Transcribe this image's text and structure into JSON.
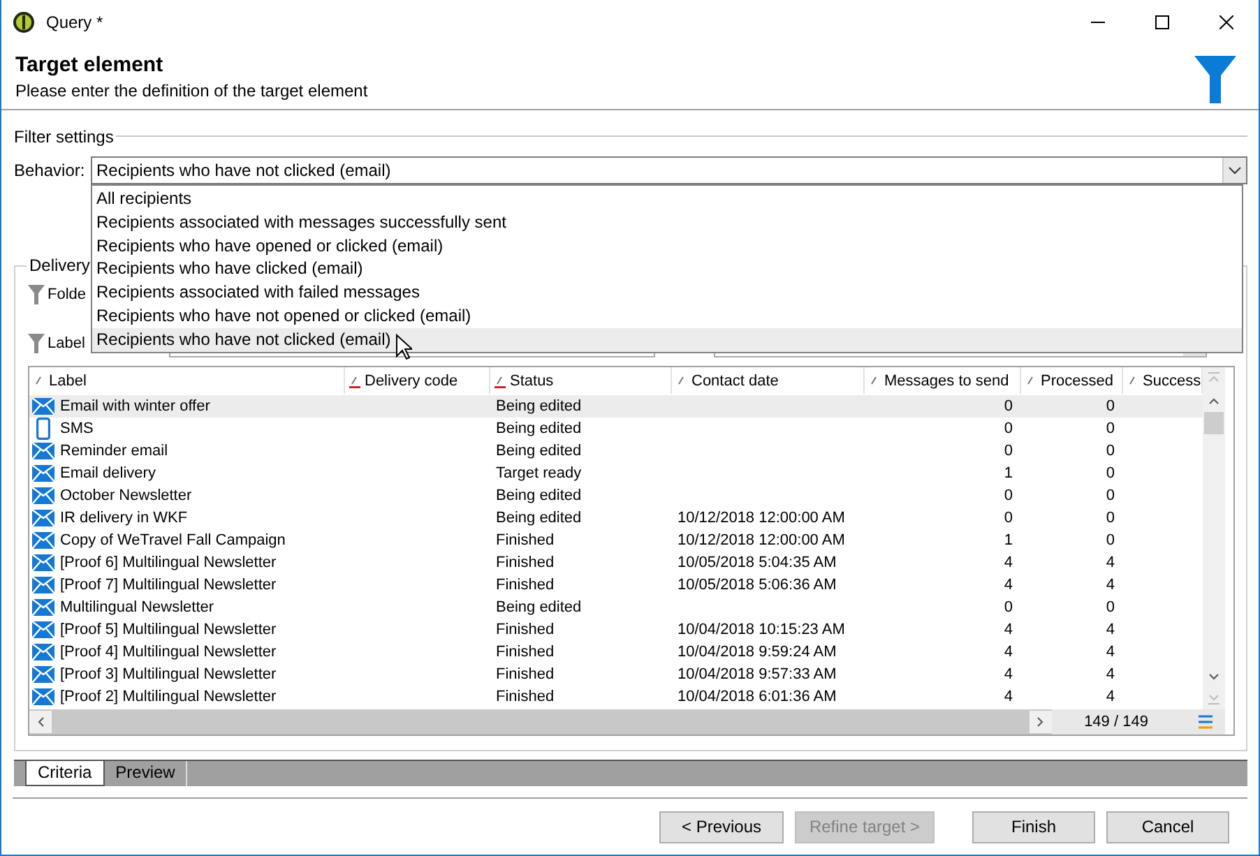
{
  "window": {
    "title": "Query *"
  },
  "header": {
    "title": "Target element",
    "subtitle": "Please enter the definition of the target element"
  },
  "filter_settings": {
    "legend": "Filter settings",
    "behavior_label": "Behavior:",
    "behavior_value": "Recipients who have not clicked (email)",
    "options": [
      {
        "label": "All recipients",
        "selected": false
      },
      {
        "label": "Recipients associated with messages successfully sent",
        "selected": false
      },
      {
        "label": "Recipients who have opened or clicked (email)",
        "selected": false
      },
      {
        "label": "Recipients who have clicked (email)",
        "selected": false
      },
      {
        "label": "Recipients associated with failed messages",
        "selected": false
      },
      {
        "label": "Recipients who have not opened or clicked (email)",
        "selected": false
      },
      {
        "label": "Recipients who have not clicked (email)",
        "selected": true
      }
    ]
  },
  "delivery": {
    "legend": "Delivery",
    "folder_label": "Folde",
    "label_label": "Label"
  },
  "table": {
    "columns": [
      {
        "label": "Label",
        "marked": false
      },
      {
        "label": "Delivery code",
        "marked": true
      },
      {
        "label": "Status",
        "marked": true
      },
      {
        "label": "Contact date",
        "marked": false
      },
      {
        "label": "Messages to send",
        "marked": false
      },
      {
        "label": "Processed",
        "marked": false
      },
      {
        "label": "Success",
        "marked": false
      }
    ],
    "rows": [
      {
        "kind": "email",
        "label": "Email with winter offer",
        "status": "Being edited",
        "to_send": "0",
        "processed": "0",
        "selected": true
      },
      {
        "kind": "sms",
        "label": "SMS",
        "status": "Being edited",
        "to_send": "0",
        "processed": "0",
        "selected": false
      },
      {
        "kind": "email",
        "label": "Reminder email",
        "status": "Being edited",
        "to_send": "0",
        "processed": "0",
        "selected": false
      },
      {
        "kind": "email",
        "label": "Email delivery",
        "status": "Target ready",
        "to_send": "1",
        "processed": "0",
        "selected": false
      },
      {
        "kind": "email",
        "label": "October Newsletter",
        "status": "Being edited",
        "to_send": "0",
        "processed": "0",
        "selected": false
      },
      {
        "kind": "email",
        "label": "IR delivery in WKF",
        "status": "Being edited",
        "contact_date": "10/12/2018 12:00:00 AM",
        "to_send": "0",
        "processed": "0",
        "selected": false
      },
      {
        "kind": "email",
        "label": "Copy of WeTravel Fall Campaign",
        "status": "Finished",
        "contact_date": "10/12/2018 12:00:00 AM",
        "to_send": "1",
        "processed": "0",
        "selected": false
      },
      {
        "kind": "email",
        "label": "[Proof 6] Multilingual Newsletter",
        "status": "Finished",
        "contact_date": "10/05/2018 5:04:35 AM",
        "to_send": "4",
        "processed": "4",
        "selected": false
      },
      {
        "kind": "email",
        "label": "[Proof 7] Multilingual Newsletter",
        "status": "Finished",
        "contact_date": "10/05/2018 5:06:36 AM",
        "to_send": "4",
        "processed": "4",
        "selected": false
      },
      {
        "kind": "email",
        "label": "Multilingual Newsletter",
        "status": "Being edited",
        "to_send": "0",
        "processed": "0",
        "selected": false
      },
      {
        "kind": "email",
        "label": "[Proof 5] Multilingual Newsletter",
        "status": "Finished",
        "contact_date": "10/04/2018 10:15:23 AM",
        "to_send": "4",
        "processed": "4",
        "selected": false
      },
      {
        "kind": "email",
        "label": "[Proof 4] Multilingual Newsletter",
        "status": "Finished",
        "contact_date": "10/04/2018 9:59:24 AM",
        "to_send": "4",
        "processed": "4",
        "selected": false
      },
      {
        "kind": "email",
        "label": "[Proof 3] Multilingual Newsletter",
        "status": "Finished",
        "contact_date": "10/04/2018 9:57:33 AM",
        "to_send": "4",
        "processed": "4",
        "selected": false
      },
      {
        "kind": "email",
        "label": "[Proof 2] Multilingual Newsletter",
        "status": "Finished",
        "contact_date": "10/04/2018 6:01:36 AM",
        "to_send": "4",
        "processed": "4",
        "selected": false
      }
    ],
    "count": "149 / 149"
  },
  "tabs": [
    {
      "label": "Criteria",
      "selected": true
    },
    {
      "label": "Preview",
      "selected": false
    }
  ],
  "buttons": [
    {
      "label": "< Previous",
      "disabled": false
    },
    {
      "label": "Refine target >",
      "disabled": true
    },
    {
      "label": "Finish",
      "disabled": false
    },
    {
      "label": "Cancel",
      "disabled": false
    }
  ]
}
